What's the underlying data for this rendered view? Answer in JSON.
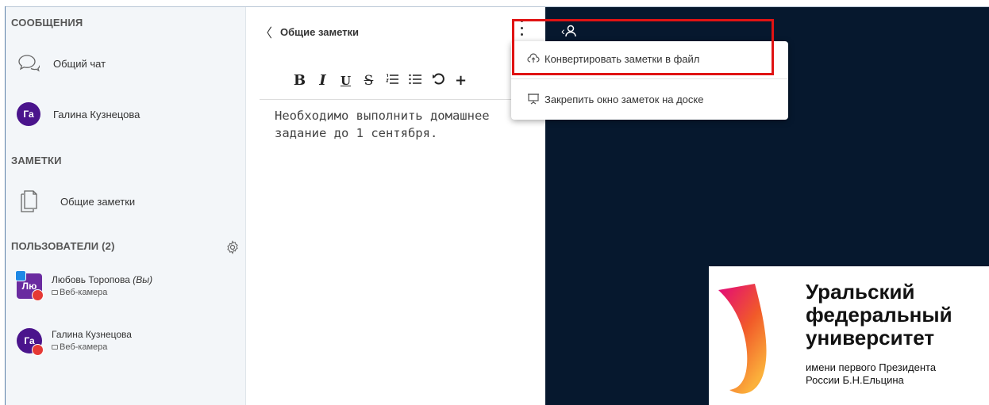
{
  "sidebar": {
    "messages_title": "СООБЩЕНИЯ",
    "public_chat_label": "Общий чат",
    "private_chat": {
      "avatar": "Га",
      "name": "Галина Кузнецова"
    },
    "notes_title": "ЗАМЕТКИ",
    "shared_notes_label": "Общие заметки",
    "users_title": "ПОЛЬЗОВАТЕЛИ (2)",
    "users": [
      {
        "avatar": "Лю",
        "name": "Любовь Торопова",
        "you_tag": "(Вы)",
        "sub": "Веб-камера"
      },
      {
        "avatar": "Га",
        "name": "Галина Кузнецова",
        "sub": "Веб-камера"
      }
    ]
  },
  "notes": {
    "title": "Общие заметки",
    "toolbar": [
      "B",
      "I",
      "U",
      "S"
    ],
    "text": "Необходимо выполнить домашнее задание до 1 сентября."
  },
  "menu": {
    "items": [
      {
        "label": "Конвертировать заметки в файл",
        "icon": "cloud-upload-icon"
      },
      {
        "label": "Закрепить окно заметок на доске",
        "icon": "presentation-icon"
      }
    ]
  },
  "logo": {
    "line1": "Уральский",
    "line2": "федеральный",
    "line3": "университет",
    "line4": "имени первого Президента",
    "line5": "России Б.Н.Ельцина"
  },
  "colors": {
    "accent": "#4a148c",
    "stage": "#06182e",
    "highlight": "#e01313"
  }
}
